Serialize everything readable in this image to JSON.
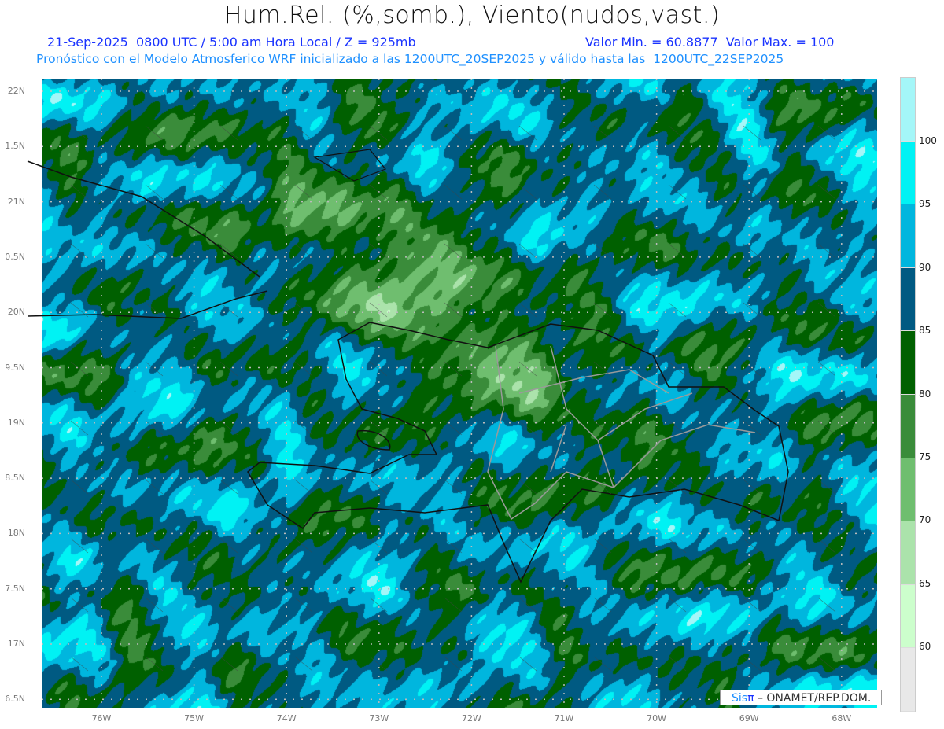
{
  "header": {
    "title": "Hum.Rel. (%,somb.), Viento(nudos,vast.)",
    "date_line": "21-Sep-2025  0800 UTC / 5:00 am Hora Local / Z = 925mb",
    "minmax_line": "Valor Min. = 60.8877  Valor Max. = 100",
    "model_line": "Pronóstico con el Modelo Atmosferico WRF inicializado a las 1200UTC_20SEP2025 y válido hasta las  1200UTC_22SEP2025"
  },
  "axes": {
    "lat_labels": [
      "22N",
      "1.5N",
      "21N",
      "0.5N",
      "20N",
      "9.5N",
      "19N",
      "8.5N",
      "18N",
      "7.5N",
      "17N",
      "6.5N"
    ],
    "lon_labels": [
      "76W",
      "75W",
      "74W",
      "73W",
      "72W",
      "71W",
      "70W",
      "69W",
      "68W"
    ]
  },
  "colorbar": {
    "labels": [
      "100",
      "95",
      "90",
      "85",
      "80",
      "75",
      "70",
      "65",
      "60"
    ],
    "colors": [
      "#a4f6f8",
      "#00f2f4",
      "#00b6de",
      "#005a82",
      "#006000",
      "#3a8c3a",
      "#6fbe6f",
      "#abe3ab",
      "#ccfecc",
      "#e8e8e8"
    ]
  },
  "credit": {
    "sis": "Sis",
    "pi": "π",
    "text": " – ONAMET/REP.DOM."
  },
  "stats": {
    "min": 60.8877,
    "max": 100
  }
}
